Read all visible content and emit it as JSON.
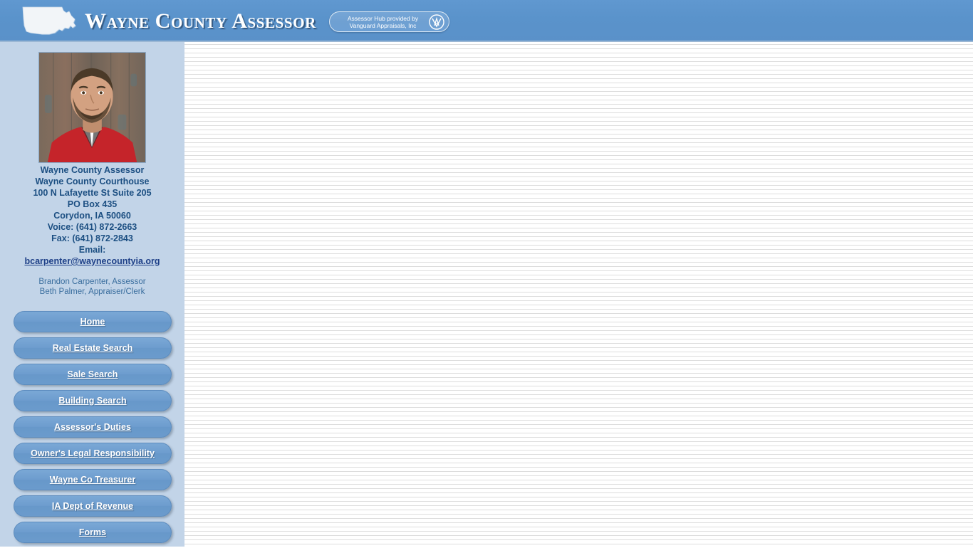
{
  "header": {
    "title": "Wayne County Assessor",
    "map_icon": "iowa-state-outline-icon",
    "badge": {
      "line1": "Assessor Hub provided by",
      "line2": "Vanguard Appraisals, Inc",
      "logo_icon": "vanguard-va-monogram-icon"
    },
    "background_color": "#5a93cb"
  },
  "sidebar": {
    "background_color": "#c2d4e8",
    "photo_alt": "assessor-portrait-photo",
    "contact": [
      "Wayne County Assessor",
      "Wayne County Courthouse",
      "100 N Lafayette St Suite 205",
      "PO Box 435",
      "Corydon, IA 50060",
      "Voice: (641) 872-2663",
      "Fax: (641) 872-2843",
      "Email:"
    ],
    "email": "bcarpenter@waynecountyia.org",
    "staff": [
      "Brandon Carpenter, Assessor",
      "Beth Palmer, Appraiser/Clerk"
    ],
    "nav": [
      {
        "label": "Home"
      },
      {
        "label": "Real Estate Search"
      },
      {
        "label": "Sale Search"
      },
      {
        "label": "Building Search"
      },
      {
        "label": "Assessor's Duties"
      },
      {
        "label": "Owner's Legal Responsibility"
      },
      {
        "label": "Wayne Co Treasurer"
      },
      {
        "label": "IA Dept of Revenue"
      },
      {
        "label": "Forms"
      }
    ],
    "nav_button_color": "#6d9cce",
    "nav_text_color": "#ffffff"
  },
  "content": {
    "body_text": "",
    "background_color": "#ffffff"
  }
}
